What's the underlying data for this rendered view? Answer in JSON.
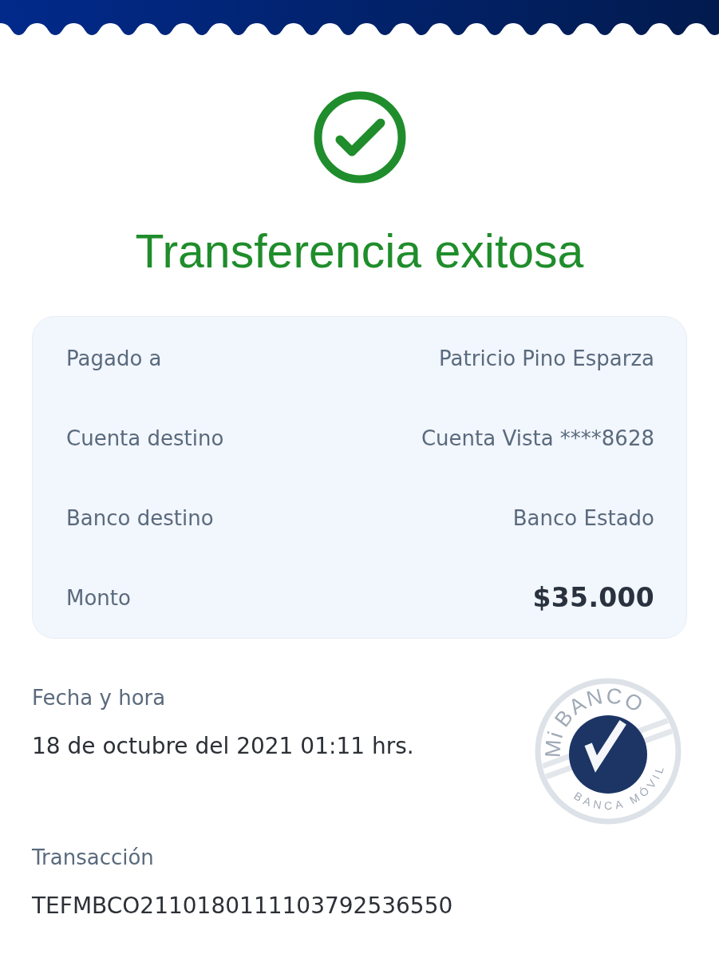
{
  "result": {
    "kind": "success",
    "title": "Transferencia exitosa"
  },
  "details": [
    {
      "label": "Pagado a",
      "value": "Patricio Pino Esparza",
      "emphasis": false
    },
    {
      "label": "Cuenta destino",
      "value": "Cuenta Vista ****8628",
      "emphasis": false
    },
    {
      "label": "Banco destino",
      "value": "Banco Estado",
      "emphasis": false
    },
    {
      "label": "Monto",
      "value": "$35.000",
      "emphasis": true
    }
  ],
  "info": [
    {
      "label": "Fecha y hora",
      "value": "18 de octubre del 2021 01:11 hrs."
    },
    {
      "label": "Transacción",
      "value": "TEFMBCO2110180111103792536550"
    }
  ],
  "stamp": {
    "brand_prefix": "Mi",
    "brand_name": "BANCO",
    "tagline": "BANCA MÓVIL"
  }
}
